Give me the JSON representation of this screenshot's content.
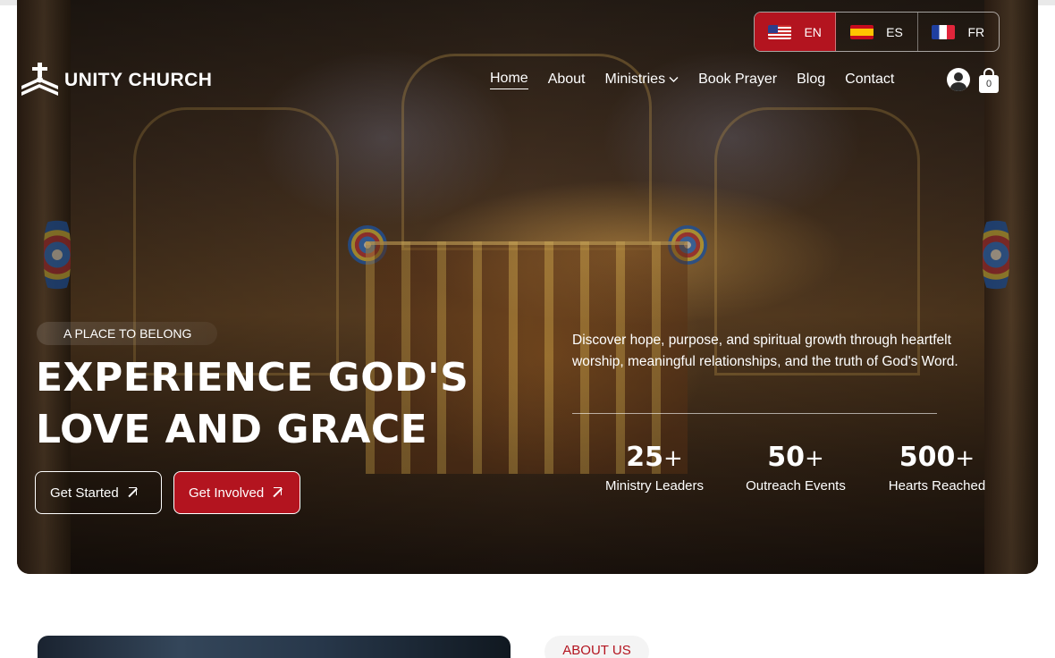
{
  "languages": [
    {
      "code": "EN",
      "flag": "us-flag-icon",
      "active": true
    },
    {
      "code": "ES",
      "flag": "spain-flag-icon",
      "active": false
    },
    {
      "code": "FR",
      "flag": "france-flag-icon",
      "active": false
    }
  ],
  "brand": {
    "name": "UNITY CHURCH",
    "logo_icon": "cross-logo-icon"
  },
  "nav": {
    "home": "Home",
    "about": "About",
    "ministries": "Ministries",
    "book_prayer": "Book Prayer",
    "blog": "Blog",
    "contact": "Contact"
  },
  "cart": {
    "count": "0"
  },
  "hero": {
    "eyebrow": "A PLACE TO BELONG",
    "headline": "EXPERIENCE GOD'S LOVE AND GRACE",
    "description": "Discover hope, purpose, and spiritual growth through heartfelt worship, meaningful relationships, and the truth of God's Word.",
    "buttons": {
      "primary": "Get Started",
      "secondary": "Get Involved"
    },
    "stats": [
      {
        "value": "25",
        "suffix": "+",
        "label": "Ministry Leaders"
      },
      {
        "value": "50",
        "suffix": "+",
        "label": "Outreach Events"
      },
      {
        "value": "500",
        "suffix": "+",
        "label": "Hearts Reached"
      }
    ]
  },
  "about": {
    "tag": "ABOUT US"
  },
  "colors": {
    "accent": "#b3141f",
    "text_on_dark": "#ffffff"
  }
}
